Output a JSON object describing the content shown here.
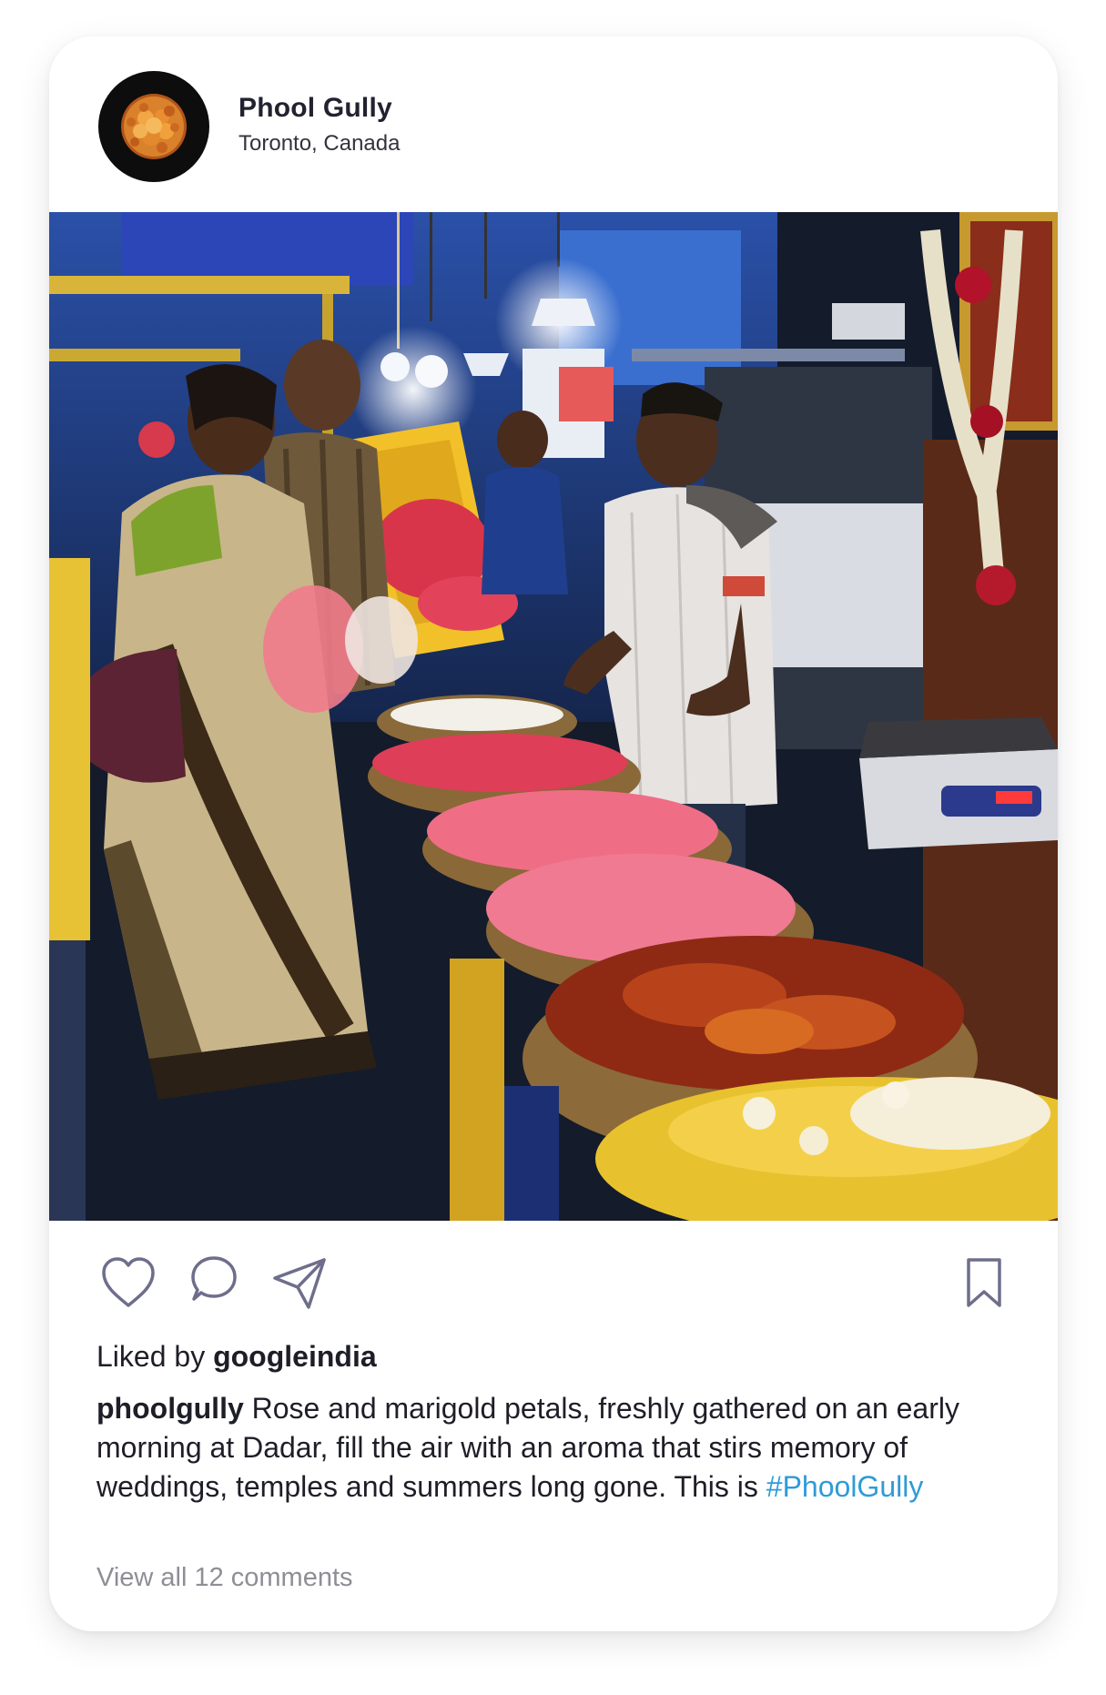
{
  "post": {
    "account_name": "Phool Gully",
    "location": "Toronto, Canada",
    "liked_prefix": "Liked by",
    "liked_user": "googleindia",
    "caption_user": "phoolgully",
    "caption_text": "Rose and marigold petals, freshly gathered on an early morning at Dadar, fill the air with an aroma that stirs memory of weddings, temples and summers long gone. This is",
    "hashtag": "#PhoolGully",
    "view_comments": "View all 12 comments"
  },
  "icons": [
    "heart-icon",
    "comment-icon",
    "share-icon",
    "bookmark-icon"
  ],
  "colors": {
    "icon_stroke": "#6e6e8c",
    "hashtag": "#2f9bd6",
    "muted_text": "#8e8e96",
    "avatar_bg": "#0d0d0d"
  }
}
